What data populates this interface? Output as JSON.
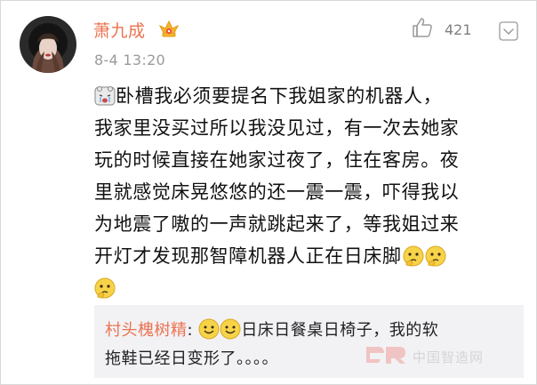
{
  "post": {
    "username": "萧九成",
    "timestamp": "8-4 13:20",
    "like_count": "421"
  },
  "comment": {
    "line1": "卧槽我必须要提名下我姐家的机器人，",
    "line2": "我家里没买过所以我没见过，有一次去她家",
    "line3": "玩的时候直接在她家过夜了，住在客房。夜",
    "line4": "里就感觉床晃悠悠的还一震一震，吓得我以",
    "line5": "为地震了嗷的一声就跳起来了，等我姐过来",
    "line6": "开灯才发现那智障机器人正在日床脚"
  },
  "reply": {
    "username": "村头槐树精",
    "separator": ":",
    "text1": "日床日餐桌日椅子，我的软",
    "text2": "拖鞋已经日变形了。。。。"
  },
  "watermark": {
    "text": "中国智造网"
  },
  "colors": {
    "username": "#eb7350",
    "timestamp": "#9a9a9a",
    "reply_bg": "#f2f2f5",
    "icon_gray": "#9a9a9a"
  },
  "icons": [
    "crown-icon",
    "thumbs-up-icon",
    "more-icon",
    "cry-face-emoji",
    "thinking-face-emoji",
    "smile-face-emoji",
    "logo-icon"
  ]
}
